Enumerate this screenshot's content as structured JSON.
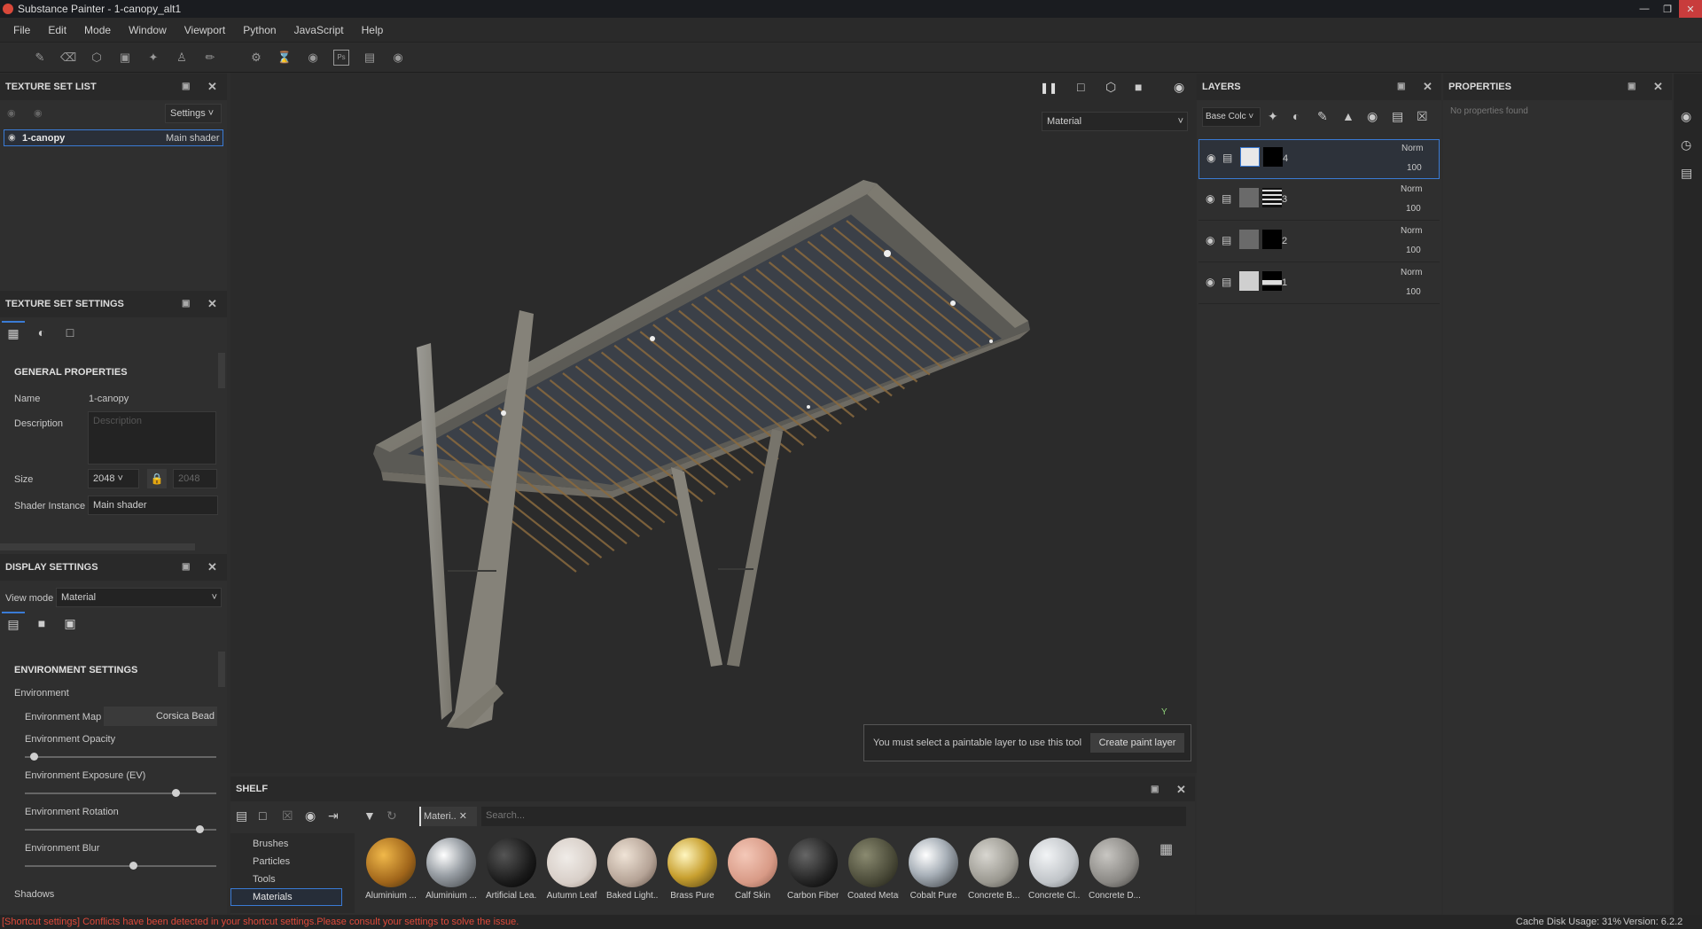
{
  "window": {
    "title": "Substance Painter - 1-canopy_alt1"
  },
  "menu": [
    "File",
    "Edit",
    "Mode",
    "Window",
    "Viewport",
    "Python",
    "JavaScript",
    "Help"
  ],
  "texture_set_list": {
    "title": "TEXTURE SET LIST",
    "settings_label": "Settings",
    "item_name": "1-canopy",
    "item_shader": "Main shader"
  },
  "texture_set_settings": {
    "title": "TEXTURE SET SETTINGS",
    "general_title": "GENERAL PROPERTIES",
    "name_label": "Name",
    "name_value": "1-canopy",
    "description_label": "Description",
    "description_placeholder": "Description",
    "size_label": "Size",
    "size_value": "2048",
    "size_value2": "2048",
    "shader_label": "Shader Instance",
    "shader_value": "Main shader"
  },
  "display_settings": {
    "title": "DISPLAY SETTINGS",
    "view_mode_label": "View mode",
    "view_mode_value": "Material",
    "env_title": "ENVIRONMENT SETTINGS",
    "environment_label": "Environment",
    "env_map_label": "Environment Map",
    "env_map_value": "Corsica Bead",
    "opacity_label": "Environment Opacity",
    "exposure_label": "Environment Exposure (EV)",
    "rotation_label": "Environment Rotation",
    "blur_label": "Environment Blur",
    "shadows_label": "Shadows",
    "sliders": {
      "opacity": 0.03,
      "exposure": 0.79,
      "rotation": 0.92,
      "blur": 0.56
    }
  },
  "viewport": {
    "mode_value": "Material",
    "notice_text": "You must select a paintable layer to use this tool",
    "create_paint_label": "Create paint layer",
    "axis_label": "Y"
  },
  "layers": {
    "title": "LAYERS",
    "channel_value": "Base Colc",
    "items": [
      {
        "name": "4",
        "blend": "Norm",
        "opacity": "100"
      },
      {
        "name": "3",
        "blend": "Norm",
        "opacity": "100"
      },
      {
        "name": "2",
        "blend": "Norm",
        "opacity": "100"
      },
      {
        "name": "1",
        "blend": "Norm",
        "opacity": "100"
      }
    ]
  },
  "properties": {
    "title": "PROPERTIES",
    "empty_text": "No properties found"
  },
  "shelf": {
    "title": "SHELF",
    "filter_tag": "Materi..",
    "search_placeholder": "Search...",
    "categories": [
      "Brushes",
      "Particles",
      "Tools",
      "Materials"
    ],
    "materials": [
      "Aluminium ...",
      "Aluminium ...",
      "Artificial Lea...",
      "Autumn Leaf",
      "Baked Light...",
      "Brass Pure",
      "Calf Skin",
      "Carbon Fiber",
      "Coated Metal",
      "Cobalt Pure",
      "Concrete B...",
      "Concrete Cl...",
      "Concrete D..."
    ]
  },
  "status": {
    "warning": "[Shortcut settings] Conflicts have been detected in your shortcut settings.Please consult your settings to solve the issue.",
    "cache_label": "Cache Disk Usage:",
    "cache_value": "31%",
    "version": "Version: 6.2.2"
  },
  "colors": {
    "accent": "#3a7bd5",
    "warning": "#e04a3a",
    "background": "#2b2b2b"
  }
}
